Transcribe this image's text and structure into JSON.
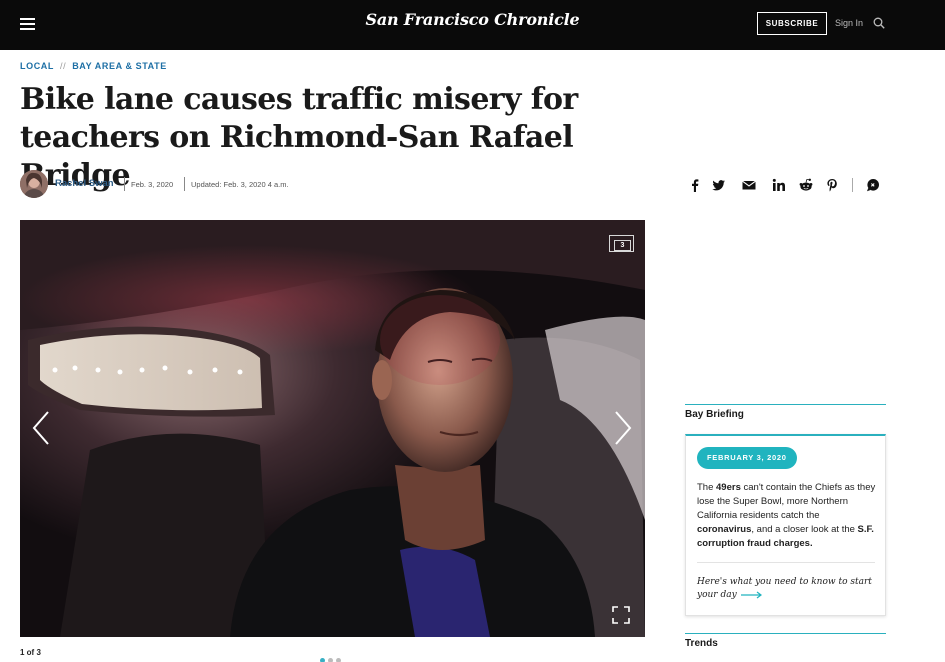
{
  "header": {
    "logo": "San Francisco Chronicle",
    "subscribe_label": "SUBSCRIBE",
    "signin_label": "Sign In"
  },
  "breadcrumb": {
    "section": "LOCAL",
    "separator": "//",
    "subsection": "BAY AREA & STATE"
  },
  "article": {
    "headline": "Bike lane causes traffic misery for teachers on Richmond-San Rafael Bridge",
    "author": "Rachel Swan",
    "date": "Feb. 3, 2020",
    "updated": "Updated: Feb. 3, 2020 4 a.m."
  },
  "share_icons": [
    "facebook-icon",
    "twitter-icon",
    "email-icon",
    "linkedin-icon",
    "reddit-icon",
    "pinterest-icon",
    "comments-icon"
  ],
  "gallery": {
    "photo_count": "3",
    "position": "1 of 3",
    "total_dots": 3,
    "active_dot": 1
  },
  "sidebar": {
    "bay_briefing_title": "Bay Briefing",
    "card": {
      "date_pill": "FEBRUARY 3, 2020",
      "blurb_parts": [
        {
          "text": "The ",
          "bold": false
        },
        {
          "text": "49ers",
          "bold": true
        },
        {
          "text": " can't contain the Chiefs as they lose the Super Bowl, more Northern California residents catch the ",
          "bold": false
        },
        {
          "text": "coronavirus",
          "bold": true
        },
        {
          "text": ", and a closer look at the ",
          "bold": false
        },
        {
          "text": "S.F. corruption fraud charges.",
          "bold": true
        }
      ],
      "cta": "Here's what you need to know to start your day"
    },
    "trends_title": "Trends"
  },
  "colors": {
    "accent_teal": "#20b4bf",
    "link_blue": "#1d6fa5",
    "topbar": "#0a0a0a"
  }
}
